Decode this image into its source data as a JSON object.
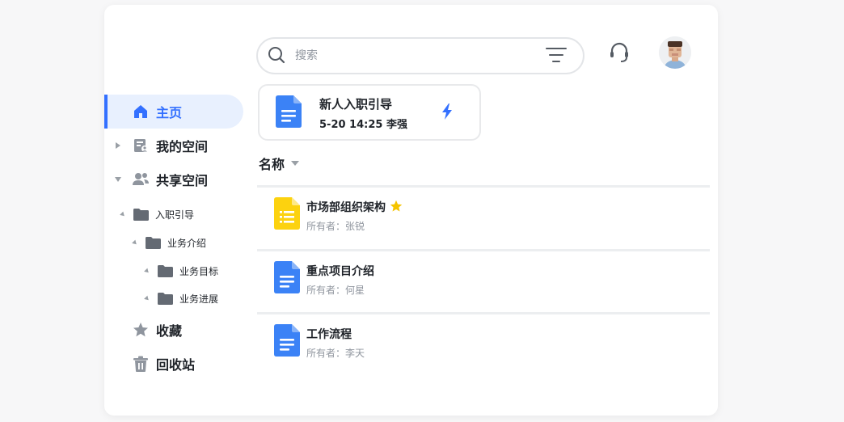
{
  "search": {
    "placeholder": "搜索"
  },
  "sidebar": {
    "items": [
      {
        "label": "主页",
        "icon": "home-icon"
      },
      {
        "label": "我的空间",
        "icon": "my-space-icon"
      },
      {
        "label": "共享空间",
        "icon": "shared-users-icon"
      },
      {
        "label": "收藏",
        "icon": "star-icon"
      },
      {
        "label": "回收站",
        "icon": "trash-icon"
      }
    ],
    "tree": [
      {
        "label": "入职引导"
      },
      {
        "label": "业务介绍"
      },
      {
        "label": "业务目标"
      },
      {
        "label": "业务进展"
      }
    ]
  },
  "recent": {
    "title": "新人入职引导",
    "meta": "5-20 14:25 李强",
    "icon": "doc-icon"
  },
  "list": {
    "sort_label": "名称",
    "files": [
      {
        "name": "市场部组织架构",
        "owner": "所有者：张锐",
        "type": "sheet",
        "starred": true
      },
      {
        "name": "重点项目介绍",
        "owner": "所有者：何星",
        "type": "doc",
        "starred": false
      },
      {
        "name": "工作流程",
        "owner": "所有者：李天",
        "type": "doc",
        "starred": false
      }
    ]
  },
  "colors": {
    "accent": "#3370ff",
    "doc_blue": "#3b82f6",
    "sheet_yellow": "#fcd20f",
    "star_yellow": "#f5c400",
    "icon_gray": "#8f959e"
  }
}
